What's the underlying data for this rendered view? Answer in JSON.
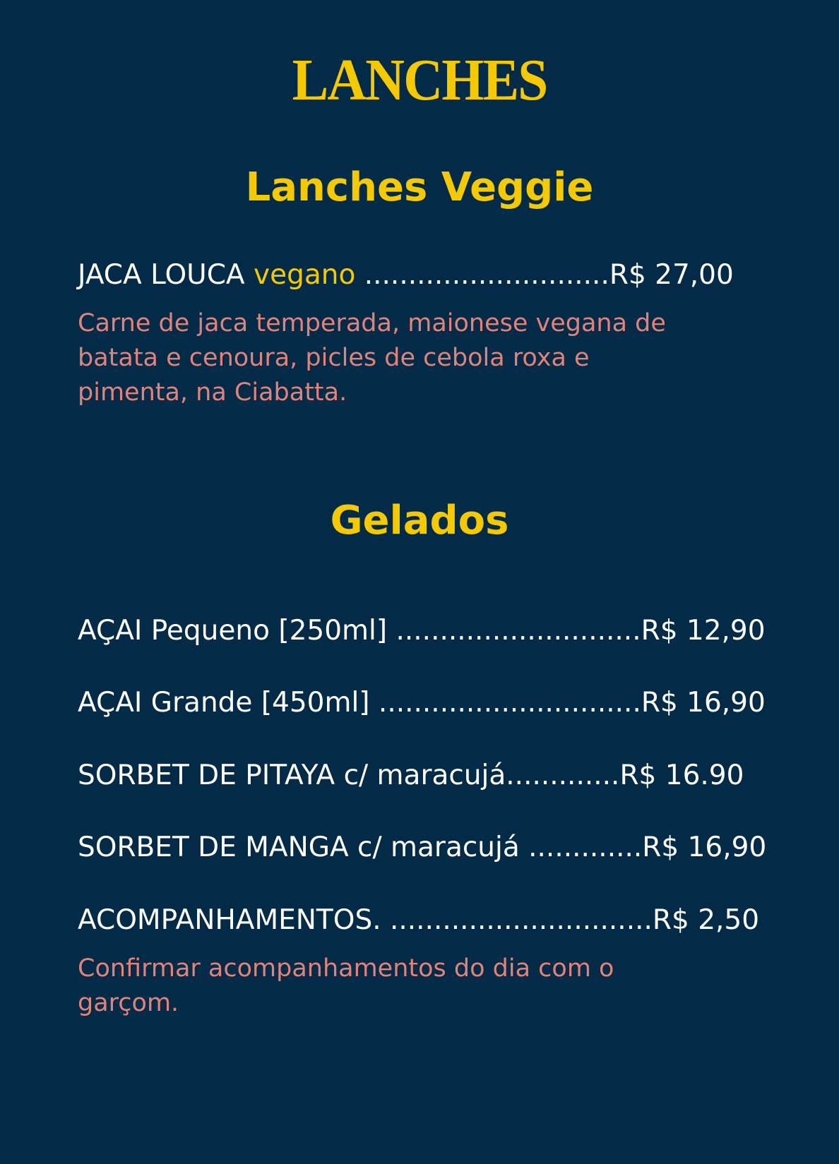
{
  "title": "LANCHES",
  "sections": [
    {
      "title": "Lanches Veggie",
      "items": [
        {
          "name": "JACA LOUCA",
          "tag": "vegano",
          "leader": " ............................",
          "price": "R$ 27,00",
          "description": "Carne de jaca temperada, maionese vegana de batata e cenoura, picles de cebola roxa e pimenta, na Ciabatta."
        }
      ]
    },
    {
      "title": "Gelados",
      "items": [
        {
          "name": "AÇAI Pequeno [250ml]",
          "leader": " ............................",
          "price": "R$ 12,90"
        },
        {
          "name": "AÇAI Grande [450ml]",
          "leader": " ..............................",
          "price": "R$ 16,90"
        },
        {
          "name": "SORBET DE PITAYA c/ maracujá",
          "leader": ".............",
          "price": "R$ 16.90"
        },
        {
          "name": "SORBET DE MANGA c/ maracujá",
          "leader": " .............",
          "price": "R$ 16,90"
        },
        {
          "name": "ACOMPANHAMENTOS.",
          "leader": " ..............................",
          "price": "R$ 2,50",
          "description": "Confirmar acompanhamentos do dia com o garçom."
        }
      ]
    }
  ],
  "colors": {
    "background": "#032a47",
    "accent": "#f5c900",
    "description": "#e0837a",
    "text": "#ffffff"
  }
}
